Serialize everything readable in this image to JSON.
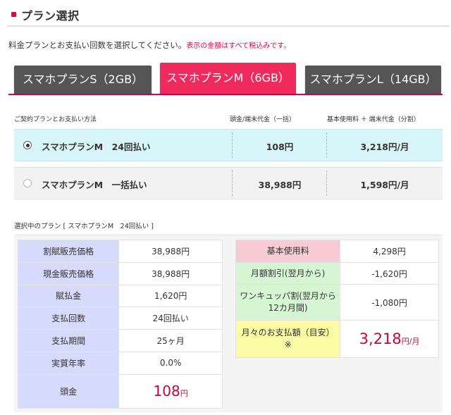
{
  "section": {
    "title": "プラン選択"
  },
  "intro": {
    "text": "料金プランとお支払い回数を選択してください。",
    "tax_note": "表示の金額はすべて税込みです。"
  },
  "tabs": [
    {
      "label": "スマホプランS（2GB）",
      "active": false
    },
    {
      "label": "スマホプランM（6GB）",
      "active": true
    },
    {
      "label": "スマホプランL（14GB）",
      "active": false
    }
  ],
  "payment_table": {
    "headers": {
      "method": "ご契約プランとお支払い方法",
      "down_payment": "頭金/端末代金（一括）",
      "monthly": "基本使用料 ＋ 端末代金（分割）"
    },
    "rows": [
      {
        "label": "スマホプランM　24回払い",
        "down_payment": "108円",
        "monthly": "3,218円/月",
        "selected": true
      },
      {
        "label": "スマホプランM　一括払い",
        "down_payment": "38,988円",
        "monthly": "1,598円/月",
        "selected": false
      }
    ]
  },
  "selected_plan": {
    "caption": "選択中のプラン [ スマホプランM　24回払い ]"
  },
  "breakdown_left": [
    {
      "label": "割賦販売価格",
      "value": "38,988円"
    },
    {
      "label": "現金販売価格",
      "value": "38,988円"
    },
    {
      "label": "賦払金",
      "value": "1,620円"
    },
    {
      "label": "支払回数",
      "value": "24回払い"
    },
    {
      "label": "支払期間",
      "value": "25ヶ月"
    },
    {
      "label": "実質年率",
      "value": "0.0%"
    },
    {
      "label": "頭金",
      "value_number": "108",
      "value_unit": "円"
    }
  ],
  "breakdown_right": [
    {
      "label": "基本使用料",
      "value": "4,298円"
    },
    {
      "label": "月額割引(翌月から)",
      "value": "-1,620円"
    },
    {
      "label": "ワンキュッパ割(翌月から12カ月間)",
      "value": "-1,080円"
    },
    {
      "label": "月々のお支払額（目安）※",
      "value_number": "3,218",
      "value_unit": "円/月"
    }
  ],
  "colors": {
    "accent": "#e5004f",
    "active_tab": "#ef2b5e",
    "inactive_tab": "#555555",
    "selected_row": "#d8f6fa",
    "left_label_bg": "#d6dafb",
    "pink_label_bg": "#f9ccd5",
    "green_label_bg": "#d6f6d3",
    "yellow_label_bg": "#fbfaa5",
    "price_red": "#d2003a"
  },
  "icons": {
    "header_bullet": "square-bullet-icon",
    "radio_checked": "radio-checked-icon",
    "radio_unchecked": "radio-unchecked-icon"
  }
}
